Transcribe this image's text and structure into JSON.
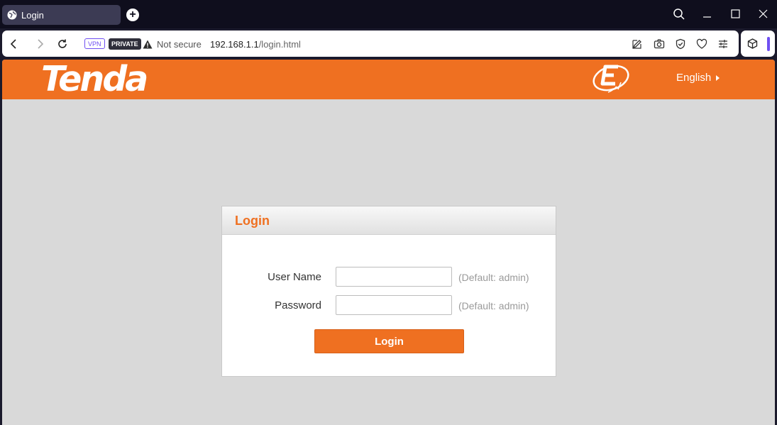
{
  "browser": {
    "tab_title": "Login",
    "vpn_label": "VPN",
    "private_label": "PRIVATE",
    "security_text": "Not secure",
    "url_host": "192.168.1.1",
    "url_path": "/login.html",
    "accent_color": "#6f4ff2"
  },
  "header": {
    "logo_text": "Tenda",
    "language": "English",
    "brand_color": "#ef7021"
  },
  "login": {
    "title": "Login",
    "username_label": "User Name",
    "username_value": "",
    "username_hint": "(Default: admin)",
    "password_label": "Password",
    "password_value": "",
    "password_hint": "(Default: admin)",
    "submit_label": "Login"
  }
}
